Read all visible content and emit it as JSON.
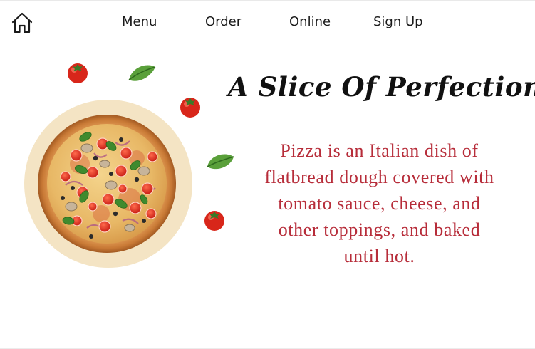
{
  "header": {
    "home_icon": "home-icon",
    "nav": [
      {
        "label": "Menu"
      },
      {
        "label": "Order"
      },
      {
        "label": "Online"
      },
      {
        "label": "Sign Up"
      }
    ]
  },
  "hero": {
    "title": "A Slice Of Perfection",
    "description": "Pizza is an Italian dish of flatbread dough covered with tomato sauce, cheese, and other toppings, and baked until hot.",
    "image": "pizza-image",
    "decorations": [
      "tomato-icon",
      "basil-leaf-icon"
    ]
  },
  "colors": {
    "accent": "#b72d3a",
    "plate": "#f4e4c4",
    "text": "#111111"
  }
}
